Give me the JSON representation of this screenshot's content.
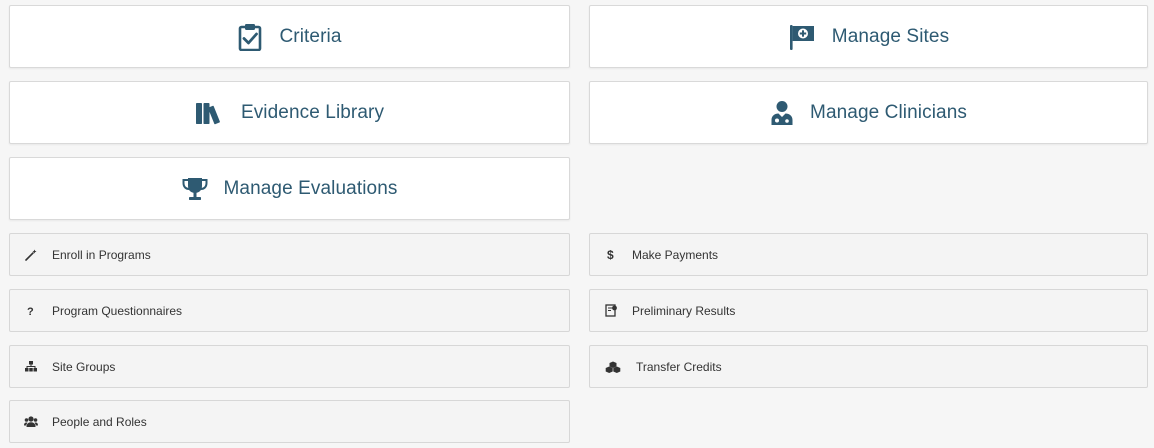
{
  "tiles": {
    "criteria": {
      "label": "Criteria",
      "icon": "clipboard-check-icon"
    },
    "manage_sites": {
      "label": "Manage Sites",
      "icon": "hospital-flag-icon"
    },
    "evidence_library": {
      "label": "Evidence Library",
      "icon": "books-icon"
    },
    "manage_clinicians": {
      "label": "Manage Clinicians",
      "icon": "doctor-icon"
    },
    "manage_evaluations": {
      "label": "Manage Evaluations",
      "icon": "trophy-icon"
    }
  },
  "links": {
    "enroll": {
      "label": "Enroll in Programs",
      "icon": "magic-wand-icon"
    },
    "payments": {
      "label": "Make Payments",
      "icon": "dollar-icon"
    },
    "questionnaires": {
      "label": "Program Questionnaires",
      "icon": "question-icon"
    },
    "preliminary": {
      "label": "Preliminary Results",
      "icon": "report-icon"
    },
    "site_groups": {
      "label": "Site Groups",
      "icon": "sitemap-icon"
    },
    "transfer": {
      "label": "Transfer Credits",
      "icon": "cubes-icon"
    },
    "people": {
      "label": "People and Roles",
      "icon": "users-icon"
    }
  },
  "colors": {
    "accent": "#2e5a72",
    "page_bg": "#f6f6f6",
    "tile_bg": "#ffffff",
    "link_bg": "#f4f4f4"
  }
}
